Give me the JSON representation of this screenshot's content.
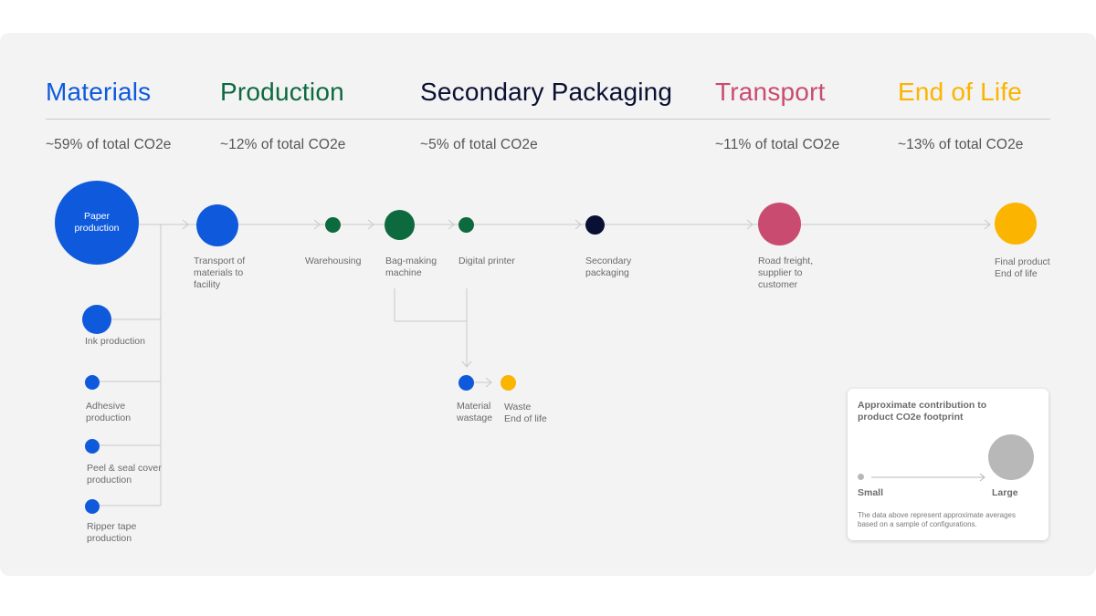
{
  "colors": {
    "materials": "#0f5adc",
    "production": "#0d6a3f",
    "packaging": "#0a1033",
    "transport": "#c94c70",
    "end_of_life": "#fbb400",
    "legend_circle": "#b8b8b8"
  },
  "stages": [
    {
      "title": "Materials",
      "share": "~59% of total CO2e"
    },
    {
      "title": "Production",
      "share": "~12% of total CO2e"
    },
    {
      "title": "Secondary Packaging",
      "share": "~5% of total CO2e"
    },
    {
      "title": "Transport",
      "share": "~11% of total CO2e"
    },
    {
      "title": "End of Life",
      "share": "~13% of total CO2e"
    }
  ],
  "nodes": {
    "paper_production": "Paper\nproduction",
    "transport_of_materials": "Transport of\nmaterials to\nfacility",
    "warehousing": "Warehousing",
    "bag_making": "Bag-making\nmachine",
    "digital_printer": "Digital printer",
    "secondary_packaging": "Secondary\npackaging",
    "road_freight": "Road freight,\nsupplier to\ncustomer",
    "final_product": "Final product\nEnd of life",
    "ink_production": "Ink production",
    "adhesive_production": "Adhesive\nproduction",
    "peel_seal": "Peel & seal cover\nproduction",
    "ripper_tape": "Ripper tape\nproduction",
    "material_wastage": "Material\nwastage",
    "waste": "Waste\nEnd of life"
  },
  "legend": {
    "title": "Approximate contribution to\nproduct CO2e footprint",
    "small": "Small",
    "large": "Large",
    "note": "The data above represent approximate averages\nbased on a sample of configurations."
  }
}
